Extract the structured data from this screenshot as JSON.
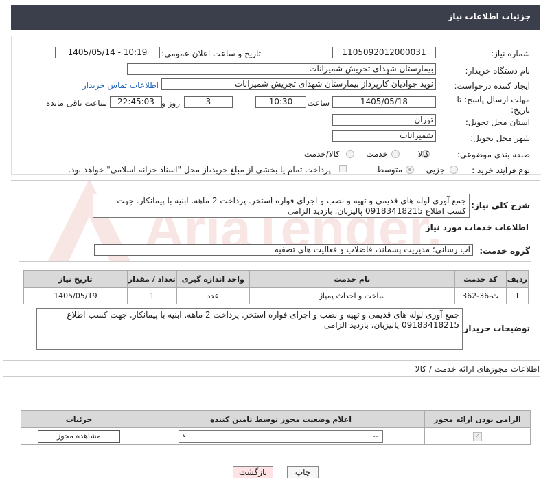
{
  "header": {
    "title": "جزئیات اطلاعات نیاز"
  },
  "fields": {
    "need_number_label": "شماره نیاز:",
    "need_number": "1105092012000031",
    "announce_label": "تاریخ و ساعت اعلان عمومی:",
    "announce_value": "1405/05/14 - 10:19",
    "buyer_org_label": "نام دستگاه خریدار:",
    "buyer_org": "بیمارستان شهدای تجریش شمیرانات",
    "creator_label": "ایجاد کننده درخواست:",
    "creator": "نوید جوادیان کارپرداز بیمارستان شهدای تجریش شمیرانات",
    "contact_link": "اطلاعات تماس خریدار",
    "deadline_label": "مهلت ارسال پاسخ: تا تاریخ:",
    "deadline_date": "1405/05/18",
    "time_label": "ساعت",
    "deadline_time": "10:30",
    "days_value": "3",
    "days_label": "روز و",
    "remaining_time": "22:45:03",
    "remaining_label": "ساعت باقی مانده",
    "province_label": "استان محل تحویل:",
    "province": "تهران",
    "city_label": "شهر محل تحویل:",
    "city": "شمیرانات",
    "category_label": "طبقه بندی موضوعی:",
    "category_options": [
      "کالا",
      "خدمت",
      "کالا/خدمت"
    ],
    "process_label": "نوع فرآیند خرید :",
    "process_options": [
      "جزیی",
      "متوسط"
    ],
    "payment_note": "پرداخت تمام یا بخشی از مبلغ خرید،از محل \"اسناد خزانه اسلامی\" خواهد بود."
  },
  "summary": {
    "label": "شرح کلی نیاز:",
    "text": "جمع آوری لوله های قدیمی و تهیه و نصب و اجرای فواره استخر. پرداخت 2 ماهه. ابنیه با پیمانکار. جهت کسب اطلاع 09183418215 پالیزبان. بازدید الزامی"
  },
  "services": {
    "section_title": "اطلاعات خدمات مورد نیاز",
    "group_label": "گروه خدمت:",
    "group_value": "آب رسانی؛ مدیریت پسماند، فاضلاب و فعالیت های تصفیه",
    "columns": [
      "ردیف",
      "کد خدمت",
      "نام خدمت",
      "واحد اندازه گیری",
      "تعداد / مقدار",
      "تاریخ نیاز"
    ],
    "rows": [
      {
        "row": "1",
        "code": "ث-36-362",
        "name": "ساخت و احداث پمپاژ",
        "unit": "عدد",
        "qty": "1",
        "date": "1405/05/19"
      }
    ]
  },
  "buyer_notes": {
    "label": "توضیحات خریدار:",
    "text": "جمع آوری لوله های قدیمی و تهیه و نصب و اجرای فواره استخر. پرداخت 2 ماهه. ابنیه با پیمانکار. جهت کسب اطلاع 09183418215 پالیزبان. بازدید الزامی"
  },
  "permits": {
    "section_title": "اطلاعات مجوزهای ارائه خدمت / کالا",
    "columns": [
      "الزامی بودن ارائه مجوز",
      "اعلام وضعیت مجوز توسط تامین کننده",
      "جزئیات"
    ],
    "select_value": "--",
    "view_button": "مشاهده مجوز"
  },
  "footer": {
    "print_button": "چاپ",
    "back_button": "بازگشت"
  },
  "watermark_text": "AriaTender.neT",
  "colors": {
    "header_bg": "#3a3f4b",
    "link": "#1a5fb4",
    "back_btn_bg": "#fde3e3"
  }
}
